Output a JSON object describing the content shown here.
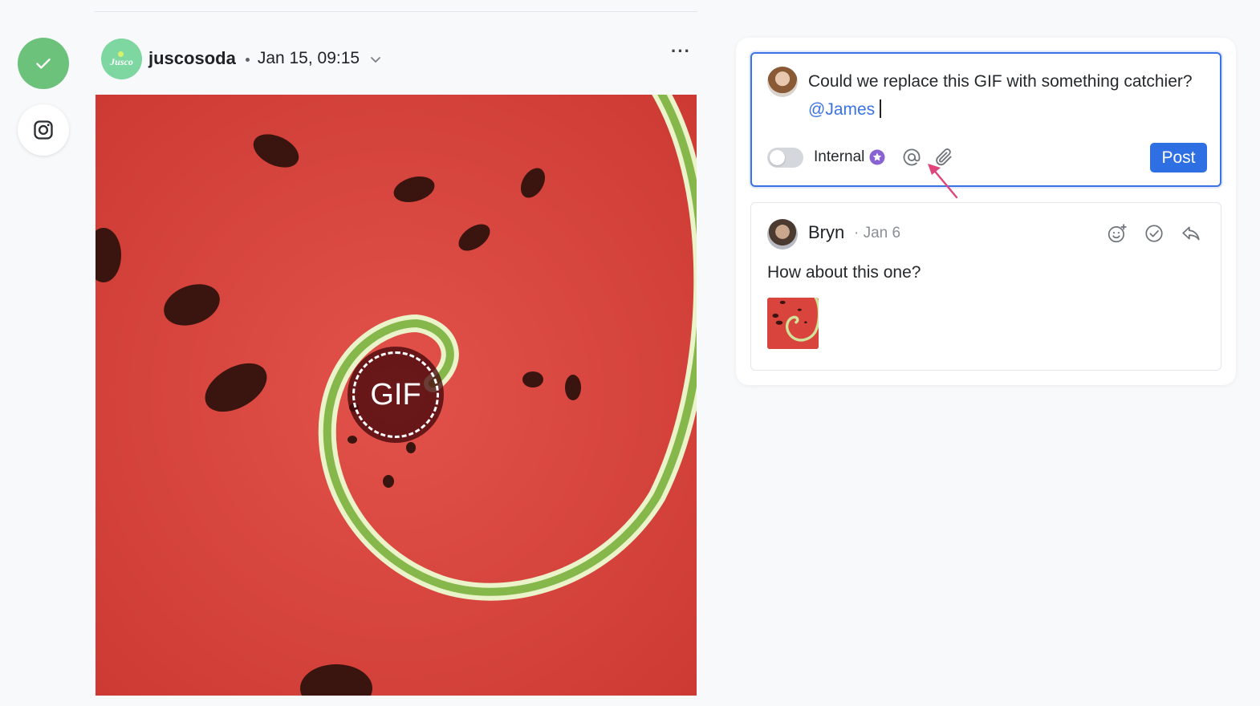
{
  "post": {
    "account": "juscosoda",
    "brand_logo_text": "Jusco",
    "date": "Jan 15, 09:15",
    "more_label": "···",
    "gif_label": "GIF"
  },
  "sidebar": {
    "approve_icon": "check-icon",
    "network_icon": "instagram-icon"
  },
  "composer": {
    "text_before": "Could we replace this GIF with something catchier? ",
    "mention": "@James",
    "internal_label": "Internal",
    "post_label": "Post"
  },
  "comment": {
    "author": "Bryn",
    "date": "· Jan 6",
    "text": "How about this one?"
  },
  "colors": {
    "accent": "#2f6fe4",
    "approve": "#6cc27a",
    "internal_badge": "#8a63d2",
    "annotation_arrow": "#e0457b"
  }
}
